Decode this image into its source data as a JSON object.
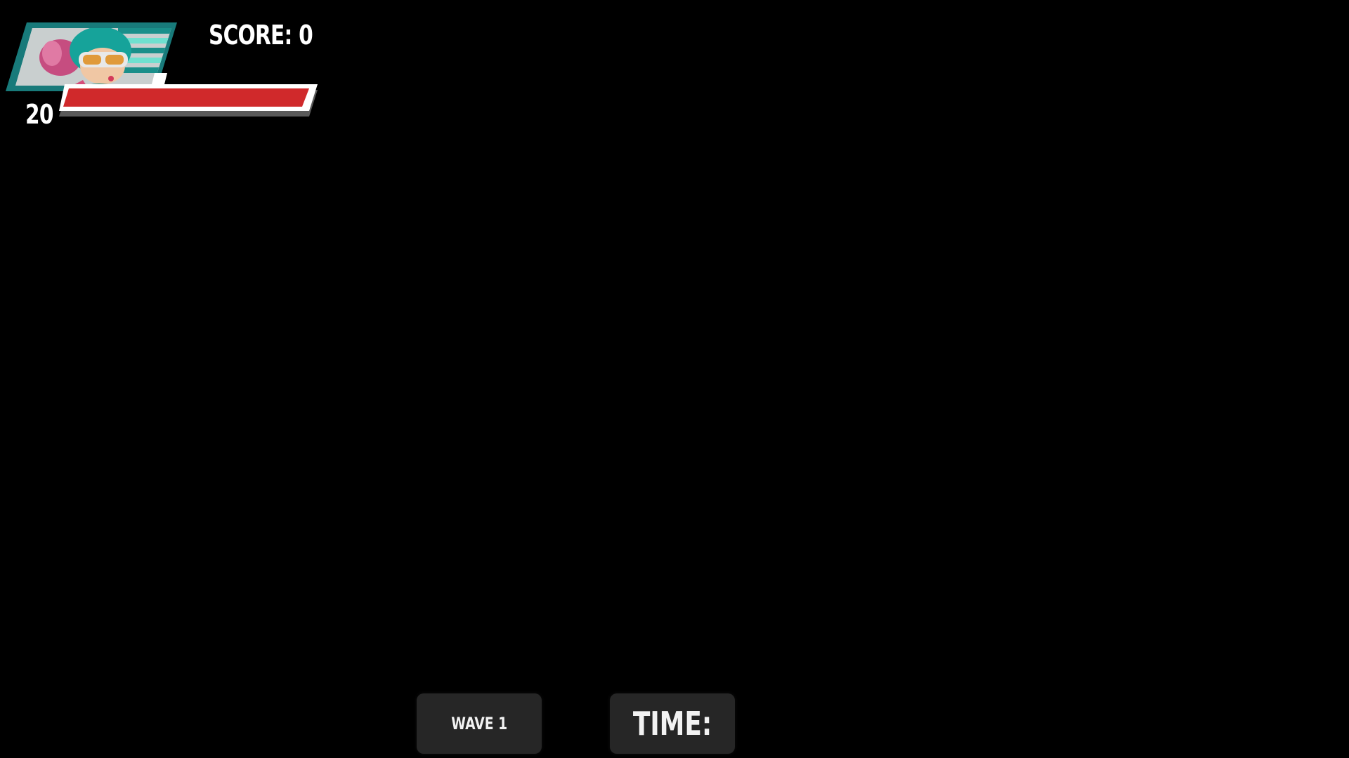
{
  "hud": {
    "score_label": "SCORE: 0",
    "level": "20",
    "health": {
      "fraction": 1.0,
      "color": "#d0292b"
    },
    "portrait": {
      "icon": "player-portrait-icon",
      "frame_color": "#1a8f8a"
    }
  },
  "bottom": {
    "wave_label": "WAVE 1",
    "time_label": "TIME:"
  },
  "colors": {
    "background": "#000000",
    "panel": "#262626",
    "text": "#ffffff"
  }
}
